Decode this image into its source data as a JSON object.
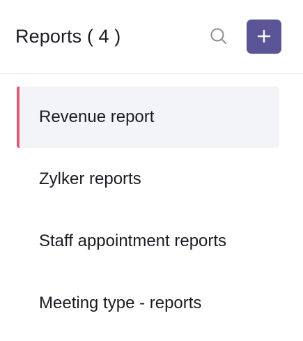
{
  "header": {
    "title": "Reports ( 4 )",
    "search_icon": "search-icon",
    "add_icon": "plus-icon",
    "add_button_color": "#5b5597"
  },
  "reports": {
    "active_index": 0,
    "accent_color": "#e05b78",
    "items": [
      {
        "label": "Revenue report"
      },
      {
        "label": "Zylker reports"
      },
      {
        "label": "Staff appointment reports"
      },
      {
        "label": "Meeting type - reports"
      }
    ]
  }
}
